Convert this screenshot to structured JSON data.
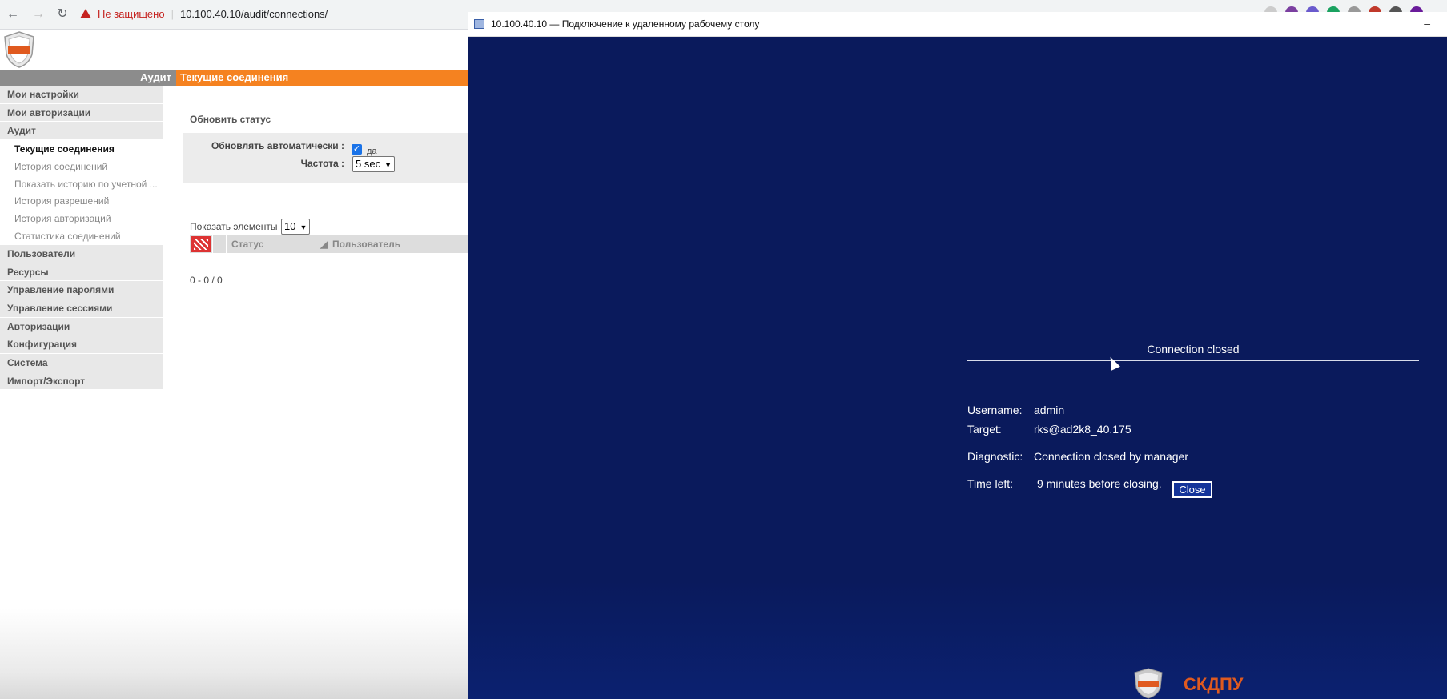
{
  "browser": {
    "security_warning": "Не защищено",
    "url": "10.100.40.10/audit/connections/"
  },
  "header": {
    "section": "Аудит",
    "page": "Текущие соединения"
  },
  "sidebar": {
    "items": [
      {
        "label": "Мои настройки"
      },
      {
        "label": "Мои авторизации"
      },
      {
        "label": "Аудит"
      }
    ],
    "audit_subitems": [
      {
        "label": "Текущие соединения",
        "active": true
      },
      {
        "label": "История соединений"
      },
      {
        "label": "Показать историю по учетной ..."
      },
      {
        "label": "История разрешений"
      },
      {
        "label": "История авторизаций"
      },
      {
        "label": "Статистика соединений"
      }
    ],
    "items_after": [
      {
        "label": "Пользователи"
      },
      {
        "label": "Ресурсы"
      },
      {
        "label": "Управление паролями"
      },
      {
        "label": "Управление сессиями"
      },
      {
        "label": "Авторизации"
      },
      {
        "label": "Конфигурация"
      },
      {
        "label": "Система"
      },
      {
        "label": "Импорт/Экспорт"
      }
    ]
  },
  "refresh": {
    "title": "Обновить статус",
    "auto_label": "Обновлять автоматически :",
    "auto_checked": true,
    "auto_value_label": "да",
    "freq_label": "Частота :",
    "freq_value": "5 sec"
  },
  "table": {
    "show_label": "Показать элементы",
    "page_size": "10",
    "columns": [
      "Статус",
      "Пользователь"
    ],
    "pager": "0 - 0 / 0"
  },
  "rdp": {
    "window_title": "10.100.40.10 — Подключение к удаленному рабочему столу",
    "dialog_title": "Connection closed",
    "username_label": "Username:",
    "username_value": "admin",
    "target_label": "Target:",
    "target_value": "rks@ad2k8_40.175",
    "diagnostic_label": "Diagnostic:",
    "diagnostic_value": "Connection closed by manager",
    "timeleft_label": "Time left:",
    "timeleft_value": "9 minutes before closing.",
    "close_button": "Close",
    "brand": "СКДПУ"
  },
  "colors": {
    "accent_orange": "#f58220",
    "rdp_background": "#0a1a5c"
  }
}
